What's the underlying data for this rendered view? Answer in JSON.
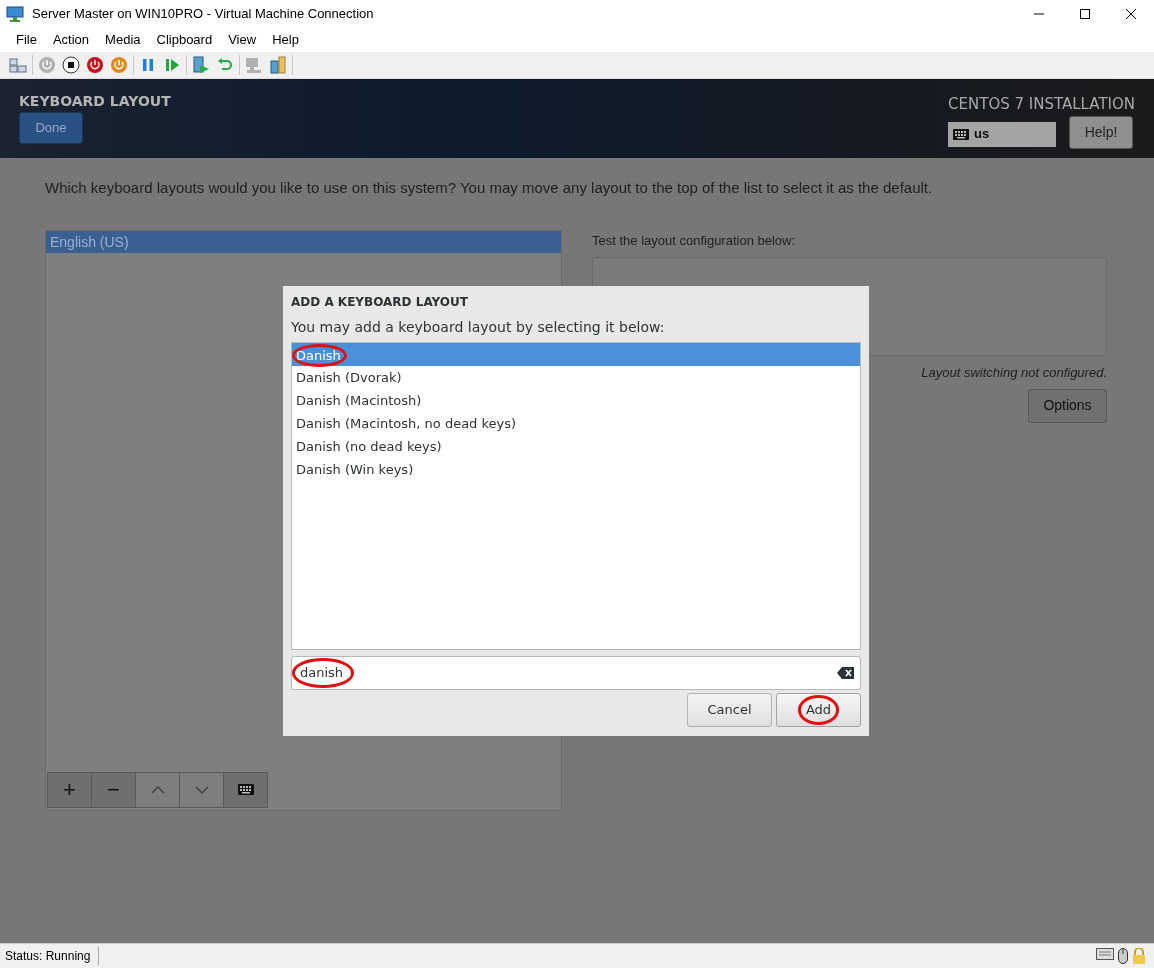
{
  "window": {
    "title": "Server Master on WIN10PRO - Virtual Machine Connection"
  },
  "menu": [
    {
      "label": "File"
    },
    {
      "label": "Action"
    },
    {
      "label": "Media"
    },
    {
      "label": "Clipboard"
    },
    {
      "label": "View"
    },
    {
      "label": "Help"
    }
  ],
  "toolbar_groups": [
    [
      {
        "kind": "ctrl-alt-del",
        "disabled": false
      }
    ],
    [
      {
        "kind": "start",
        "disabled": true
      },
      {
        "kind": "turn-off",
        "disabled": false
      },
      {
        "kind": "shut-down",
        "disabled": false
      },
      {
        "kind": "save",
        "disabled": false
      }
    ],
    [
      {
        "kind": "pause",
        "disabled": false
      },
      {
        "kind": "reset",
        "disabled": false
      }
    ],
    [
      {
        "kind": "checkpoint",
        "disabled": false
      },
      {
        "kind": "revert",
        "disabled": false
      }
    ],
    [
      {
        "kind": "enhanced-session",
        "disabled": true
      },
      {
        "kind": "share",
        "disabled": false
      }
    ]
  ],
  "installer": {
    "spoke_title": "KEYBOARD LAYOUT",
    "done_button": "Done",
    "product_title": "CENTOS 7 INSTALLATION",
    "layout_indicator": "us",
    "help_button": "Help!",
    "prompt": "Which keyboard layouts would you like to use on this system?  You may move any layout to the top of the list to select it as the default.",
    "layouts": [
      {
        "label": "English (US)",
        "selected": true
      }
    ],
    "list_buttons": [
      {
        "kind": "add",
        "label": "+",
        "disabled": false
      },
      {
        "kind": "remove",
        "label": "−",
        "disabled": false
      },
      {
        "kind": "up",
        "disabled": true
      },
      {
        "kind": "down",
        "disabled": true
      },
      {
        "kind": "preview",
        "disabled": false
      }
    ],
    "test_label": "Test the layout configuration below:",
    "switching_note": "Layout switching not configured.",
    "options_button": "Options"
  },
  "dialog": {
    "title": "ADD A KEYBOARD LAYOUT",
    "subtitle": "You may add a keyboard layout by selecting it below:",
    "options": [
      {
        "label": "Danish",
        "selected": true,
        "circled": true
      },
      {
        "label": "Danish (Dvorak)",
        "selected": false,
        "circled": false
      },
      {
        "label": "Danish (Macintosh)",
        "selected": false,
        "circled": false
      },
      {
        "label": "Danish (Macintosh, no dead keys)",
        "selected": false,
        "circled": false
      },
      {
        "label": "Danish (no dead keys)",
        "selected": false,
        "circled": false
      },
      {
        "label": "Danish (Win keys)",
        "selected": false,
        "circled": false
      }
    ],
    "search": {
      "value": "danish",
      "circled": true
    },
    "buttons": [
      {
        "kind": "cancel",
        "label": "Cancel",
        "circled": false
      },
      {
        "kind": "add",
        "label": "Add",
        "circled": true
      }
    ]
  },
  "status_bar": {
    "status": "Status: Running"
  }
}
